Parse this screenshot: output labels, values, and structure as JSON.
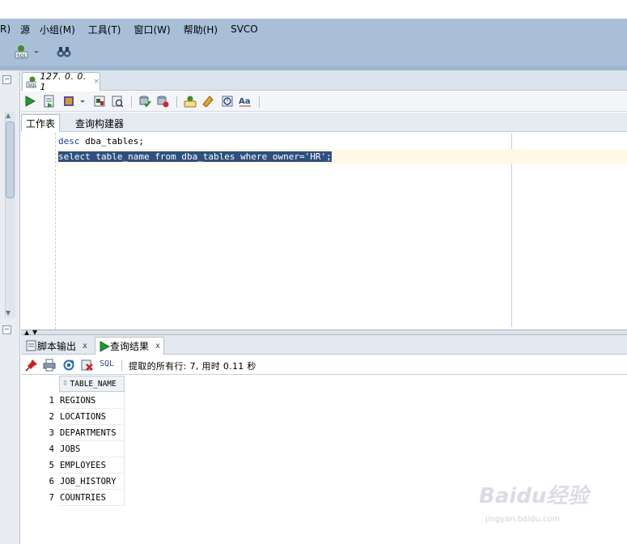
{
  "menubar": {
    "items": [
      "R)",
      "源",
      "小组(M)",
      "工具(T)",
      "窗口(W)",
      "帮助(H)",
      "SVCO"
    ]
  },
  "document_tab": {
    "title": "127. 0. 0. 1",
    "close": "×"
  },
  "editor_subtabs": [
    "工作表",
    "查询构建器"
  ],
  "code": {
    "line1_kw": "desc",
    "line1_rest": " dba_tables;",
    "line2": "select table_name from dba_tables where owner='HR';"
  },
  "results_tabs": [
    {
      "label": "脚本输出",
      "close": "x"
    },
    {
      "label": "查询结果",
      "close": "x"
    }
  ],
  "results_toolbar": {
    "sql_label": "SQL",
    "status": "提取的所有行: 7, 用时 0.11 秒"
  },
  "grid": {
    "column": "TABLE_NAME",
    "rows": [
      {
        "num": "1",
        "value": "REGIONS"
      },
      {
        "num": "2",
        "value": "LOCATIONS"
      },
      {
        "num": "3",
        "value": "DEPARTMENTS"
      },
      {
        "num": "4",
        "value": "JOBS"
      },
      {
        "num": "5",
        "value": "EMPLOYEES"
      },
      {
        "num": "6",
        "value": "JOB_HISTORY"
      },
      {
        "num": "7",
        "value": "COUNTRIES"
      }
    ]
  },
  "watermark": {
    "main": "Baidu经验",
    "sub": "jingyan.baidu.com"
  },
  "colors": {
    "menubar_bg": "#a9bfd8",
    "selection_bg": "#2f4f7f",
    "keyword": "#1f3f9a",
    "current_line": "#fdf8e8"
  },
  "icons": [
    "sql-connection-icon",
    "binoculars-icon",
    "run-statement-icon",
    "run-script-icon",
    "commit-icon",
    "rollback-icon",
    "pin-icon",
    "print-icon",
    "refresh-icon",
    "delete-icon"
  ]
}
